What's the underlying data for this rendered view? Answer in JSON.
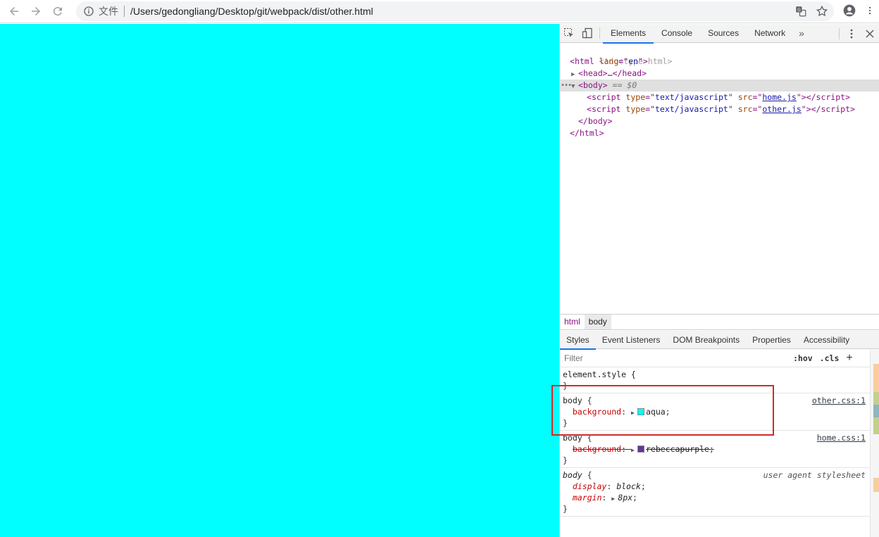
{
  "browser": {
    "back_icon": "arrow-left-icon",
    "forward_icon": "arrow-right-icon",
    "reload_icon": "reload-icon",
    "file_label": "文件",
    "url": "/Users/gedongliang/Desktop/git/webpack/dist/other.html"
  },
  "page": {
    "background_color": "#00ffff"
  },
  "devtools": {
    "tabs": [
      "Elements",
      "Console",
      "Sources",
      "Network"
    ],
    "more": "»",
    "elements": {
      "doctype": "<!doctype html>",
      "html_open": "html",
      "lang_attr": "lang",
      "lang_val": "en",
      "head": "head",
      "head_ellipsis": "…",
      "body": "body",
      "eq0": "== $0",
      "script_tag": "script",
      "type_attr": "type",
      "type_val": "text/javascript",
      "src_attr": "src",
      "script1_src": "home.js",
      "script2_src": "other.js",
      "body_close": "body",
      "html_close": "html"
    },
    "breadcrumbs": [
      "html",
      "body"
    ],
    "sub_tabs": [
      "Styles",
      "Event Listeners",
      "DOM Breakpoints",
      "Properties",
      "Accessibility"
    ],
    "filter_placeholder": "Filter",
    "hov": ":hov",
    "cls": ".cls",
    "plus": "+",
    "rules": {
      "element_style": "element.style {",
      "rule1_selector": "body",
      "rule1_source": "other.css:1",
      "rule1_prop": "background",
      "rule1_value": "aqua",
      "rule1_color": "#00ffff",
      "rule2_selector": "body",
      "rule2_source": "home.css:1",
      "rule2_prop": "background",
      "rule2_value": "rebeccapurple",
      "rule2_color": "#663399",
      "rule3_selector": "body",
      "rule3_source": "user agent stylesheet",
      "rule3_prop1": "display",
      "rule3_val1": "block",
      "rule3_prop2": "margin",
      "rule3_val2": "8px"
    }
  }
}
